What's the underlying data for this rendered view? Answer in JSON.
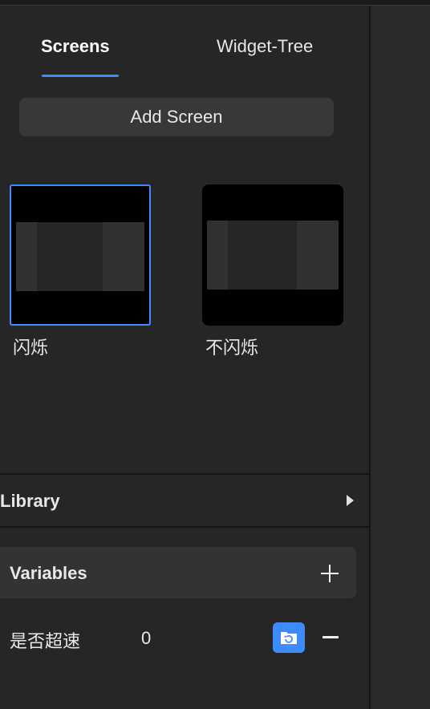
{
  "tabs": {
    "screens": "Screens",
    "widget_tree": "Widget-Tree",
    "active": "Screens"
  },
  "add_screen_label": "Add Screen",
  "screens": [
    {
      "label": "闪烁",
      "selected": true
    },
    {
      "label": "不闪烁",
      "selected": false
    }
  ],
  "library": {
    "title": "Library",
    "icon": "chevron-right-icon"
  },
  "variables": {
    "title": "Variables",
    "add_icon": "plus-icon",
    "items": [
      {
        "name": "是否超速",
        "value": "0",
        "action_icon": "folder-refresh-icon",
        "remove_icon": "minus-icon"
      }
    ]
  },
  "colors": {
    "accent": "#3d8bfd",
    "panel": "#262626",
    "button": "#383838"
  }
}
